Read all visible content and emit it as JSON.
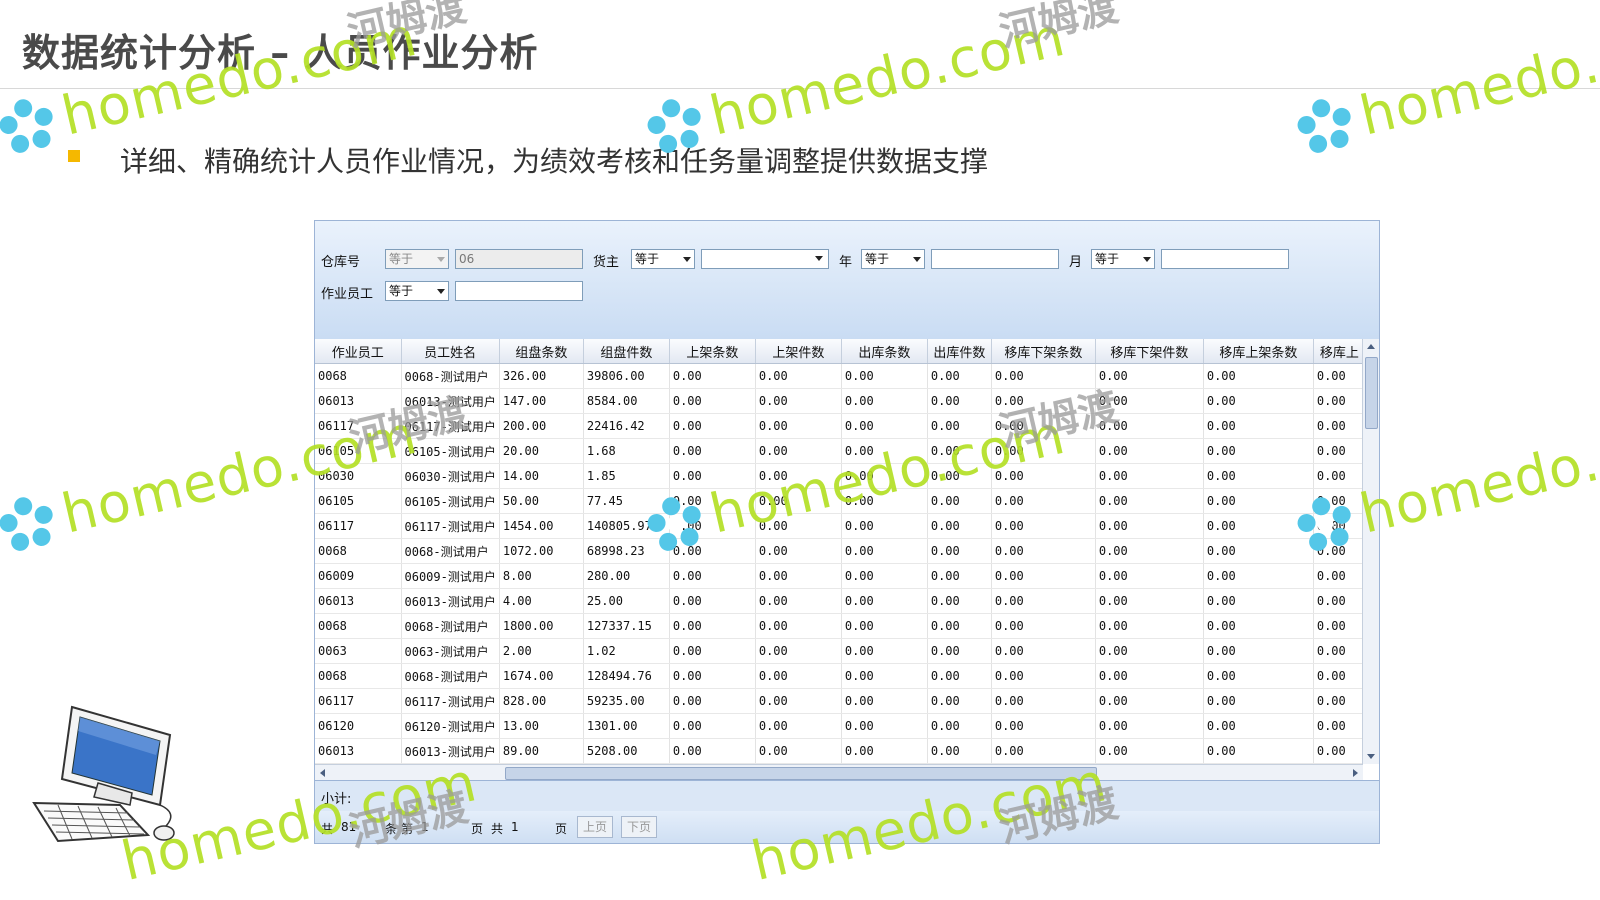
{
  "slide": {
    "title": "数据统计分析 – 人员作业分析",
    "subtitle": "详细、精确统计人员作业情况，为绩效考核和任务量调整提供数据支撑"
  },
  "watermark": {
    "brand": "homedo.com",
    "brand_cn": "河姆渡",
    "color": "#b4e026"
  },
  "filters": {
    "warehouse_label": "仓库号",
    "warehouse_op": "等于",
    "warehouse_value": "06",
    "owner_label": "货主",
    "owner_op": "等于",
    "owner_value": "",
    "year_label": "年",
    "year_op": "等于",
    "year_value": "",
    "month_label": "月",
    "month_op": "等于",
    "month_value": "",
    "worker_label": "作业员工",
    "worker_op": "等于",
    "worker_value": ""
  },
  "grid": {
    "columns": [
      "作业员工",
      "员工姓名",
      "组盘条数",
      "组盘件数",
      "上架条数",
      "上架件数",
      "出库条数",
      "出库件数",
      "移库下架条数",
      "移库下架件数",
      "移库上架条数",
      "移库上"
    ],
    "rows": [
      [
        "0068",
        "0068-测试用户",
        "326.00",
        "39806.00",
        "0.00",
        "0.00",
        "0.00",
        "0.00",
        "0.00",
        "0.00",
        "0.00",
        "0.00"
      ],
      [
        "06013",
        "06013-测试用户",
        "147.00",
        "8584.00",
        "0.00",
        "0.00",
        "0.00",
        "0.00",
        "0.00",
        "0.00",
        "0.00",
        "0.00"
      ],
      [
        "06117",
        "06117-测试用户",
        "200.00",
        "22416.42",
        "0.00",
        "0.00",
        "0.00",
        "0.00",
        "0.00",
        "0.00",
        "0.00",
        "0.00"
      ],
      [
        "06105",
        "06105-测试用户",
        "20.00",
        "1.68",
        "0.00",
        "0.00",
        "0.00",
        "0.00",
        "0.00",
        "0.00",
        "0.00",
        "0.00"
      ],
      [
        "06030",
        "06030-测试用户",
        "14.00",
        "1.85",
        "0.00",
        "0.00",
        "0.00",
        "0.00",
        "0.00",
        "0.00",
        "0.00",
        "0.00"
      ],
      [
        "06105",
        "06105-测试用户",
        "50.00",
        "77.45",
        "0.00",
        "0.00",
        "0.00",
        "0.00",
        "0.00",
        "0.00",
        "0.00",
        "0.00"
      ],
      [
        "06117",
        "06117-测试用户",
        "1454.00",
        "140805.97",
        "0.00",
        "0.00",
        "0.00",
        "0.00",
        "0.00",
        "0.00",
        "0.00",
        "0.00"
      ],
      [
        "0068",
        "0068-测试用户",
        "1072.00",
        "68998.23",
        "0.00",
        "0.00",
        "0.00",
        "0.00",
        "0.00",
        "0.00",
        "0.00",
        "0.00"
      ],
      [
        "06009",
        "06009-测试用户",
        "8.00",
        "280.00",
        "0.00",
        "0.00",
        "0.00",
        "0.00",
        "0.00",
        "0.00",
        "0.00",
        "0.00"
      ],
      [
        "06013",
        "06013-测试用户",
        "4.00",
        "25.00",
        "0.00",
        "0.00",
        "0.00",
        "0.00",
        "0.00",
        "0.00",
        "0.00",
        "0.00"
      ],
      [
        "0068",
        "0068-测试用户",
        "1800.00",
        "127337.15",
        "0.00",
        "0.00",
        "0.00",
        "0.00",
        "0.00",
        "0.00",
        "0.00",
        "0.00"
      ],
      [
        "0063",
        "0063-测试用户",
        "2.00",
        "1.02",
        "0.00",
        "0.00",
        "0.00",
        "0.00",
        "0.00",
        "0.00",
        "0.00",
        "0.00"
      ],
      [
        "0068",
        "0068-测试用户",
        "1674.00",
        "128494.76",
        "0.00",
        "0.00",
        "0.00",
        "0.00",
        "0.00",
        "0.00",
        "0.00",
        "0.00"
      ],
      [
        "06117",
        "06117-测试用户",
        "828.00",
        "59235.00",
        "0.00",
        "0.00",
        "0.00",
        "0.00",
        "0.00",
        "0.00",
        "0.00",
        "0.00"
      ],
      [
        "06120",
        "06120-测试用户",
        "13.00",
        "1301.00",
        "0.00",
        "0.00",
        "0.00",
        "0.00",
        "0.00",
        "0.00",
        "0.00",
        "0.00"
      ],
      [
        "06013",
        "06013-测试用户",
        "89.00",
        "5208.00",
        "0.00",
        "0.00",
        "0.00",
        "0.00",
        "0.00",
        "0.00",
        "0.00",
        "0.00"
      ]
    ]
  },
  "subtotal_label": "小计:",
  "pager": {
    "total_prefix": "共",
    "total_records": "81",
    "record_unit": "条",
    "page_prefix": "第",
    "current_page": "1",
    "page_unit": "页",
    "total_pages_prefix": "共",
    "total_pages": "1",
    "total_pages_unit": "页",
    "prev_label": "上页",
    "next_label": "下页"
  }
}
